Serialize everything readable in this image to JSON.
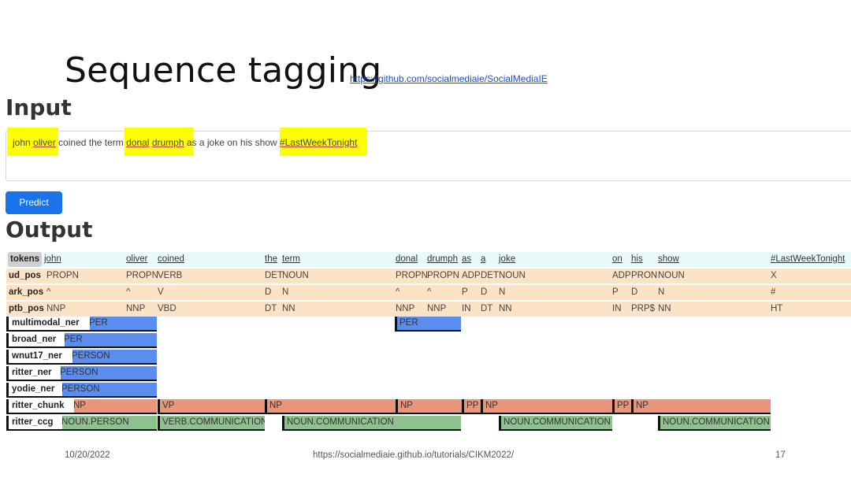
{
  "slide": {
    "title": "Sequence tagging",
    "link": "https://github.com/socialmediaie/SocialMediaIE",
    "input_heading": "Input",
    "output_heading": "Output",
    "predict_label": "Predict",
    "footer_date": "10/20/2022",
    "footer_url": "https://socialmediaie.github.io/tutorials/CIKM2022/",
    "page_number": "17"
  },
  "colors": {
    "highlight": "#ffff00",
    "button": "#1a73e8",
    "tokens_band": "#eafafa",
    "pos_band": "#fde3c6",
    "ner": "#5b8def",
    "chunk": "#e8957a",
    "ccg": "#8fc18f"
  },
  "input": {
    "text_parts": [
      "john",
      " ",
      "oliver",
      " coined the term ",
      "donal",
      " ",
      "drumph",
      " as a joke on his show ",
      "#LastWeekTonight"
    ]
  },
  "output": {
    "tokens_label": "tokens",
    "tokens": [
      "john",
      "oliver",
      "coined",
      "the",
      "term",
      "donal",
      "drumph",
      "as",
      "a",
      "joke",
      "on",
      "his",
      "show",
      "#LastWeekTonight"
    ],
    "pos_rows": [
      {
        "label": "ud_pos",
        "tags": [
          "PROPN",
          "PROPN",
          "VERB",
          "DET",
          "NOUN",
          "PROPN",
          "PROPN",
          "ADP",
          "DET",
          "NOUN",
          "ADP",
          "PRON",
          "NOUN",
          "X"
        ]
      },
      {
        "label": "ark_pos",
        "tags": [
          "^",
          "^",
          "V",
          "D",
          "N",
          "^",
          "^",
          "P",
          "D",
          "N",
          "P",
          "D",
          "N",
          "#"
        ]
      },
      {
        "label": "ptb_pos",
        "tags": [
          "NNP",
          "NNP",
          "VBD",
          "DT",
          "NN",
          "NNP",
          "NNP",
          "IN",
          "DT",
          "NN",
          "IN",
          "PRP$",
          "NN",
          "HT"
        ]
      }
    ],
    "span_rows": [
      {
        "label": "multimodal_ner",
        "kind": "ner",
        "spans": [
          {
            "tag": "PER",
            "first": "label"
          },
          {
            "tag": "PER",
            "first": 5
          }
        ]
      },
      {
        "label": "broad_ner",
        "kind": "ner",
        "spans": [
          {
            "tag": "PER"
          }
        ]
      },
      {
        "label": "wnut17_ner",
        "kind": "ner",
        "spans": [
          {
            "tag": "PERSON"
          }
        ]
      },
      {
        "label": "ritter_ner",
        "kind": "ner",
        "spans": [
          {
            "tag": "PERSON"
          }
        ]
      },
      {
        "label": "yodie_ner",
        "kind": "ner",
        "spans": [
          {
            "tag": "PERSON"
          }
        ]
      },
      {
        "label": "ritter_chunk",
        "kind": "chunk",
        "spans": [
          {
            "tag": "NP"
          },
          {
            "tag": "VP"
          },
          {
            "tag": "NP"
          },
          {
            "tag": "NP"
          },
          {
            "tag": "PP"
          },
          {
            "tag": "NP"
          },
          {
            "tag": "PP"
          },
          {
            "tag": "NP"
          }
        ]
      },
      {
        "label": "ritter_ccg",
        "kind": "ccg",
        "spans": [
          {
            "tag": "NOUN.PERSON"
          },
          {
            "tag": "VERB.COMMUNICATION"
          },
          {
            "tag": "NOUN.COMMUNICATION"
          },
          {
            "tag": "NOUN.COMMUNICATION"
          },
          {
            "tag": "NOUN.COMMUNICATION"
          }
        ]
      }
    ]
  }
}
